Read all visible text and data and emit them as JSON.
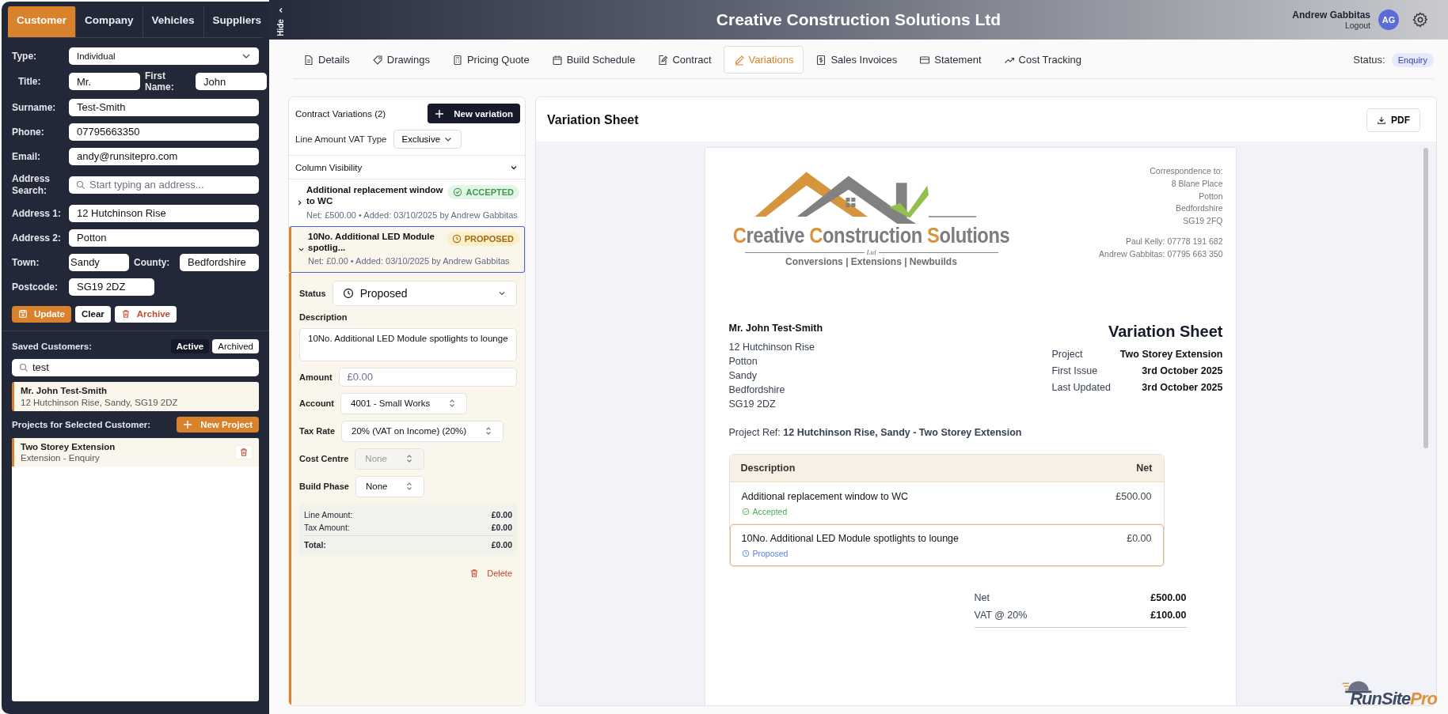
{
  "sidebar": {
    "tabs": [
      {
        "label": "Customer",
        "selected": true
      },
      {
        "label": "Company",
        "selected": false
      },
      {
        "label": "Vehicles",
        "selected": false
      },
      {
        "label": "Suppliers",
        "selected": false
      }
    ],
    "hide_label": "Hide",
    "type": {
      "label": "Type:",
      "value": "Individual"
    },
    "title": {
      "label": "Title:",
      "value": "Mr."
    },
    "first_name": {
      "label": "First Name:",
      "value": "John"
    },
    "fields": [
      {
        "label": "Surname:",
        "value": "Test-Smith"
      },
      {
        "label": "Phone:",
        "value": "07795663350"
      },
      {
        "label": "Email:",
        "value": "andy@runsitepro.com"
      }
    ],
    "address_search": {
      "label": "Address Search:",
      "placeholder": "Start typing an address..."
    },
    "address_fields": [
      {
        "label": "Address 1:",
        "value": "12 Hutchinson Rise"
      },
      {
        "label": "Address 2:",
        "value": "Potton"
      }
    ],
    "town": {
      "label": "Town:",
      "value": "Sandy"
    },
    "county": {
      "label": "County:",
      "value": "Bedfordshire"
    },
    "postcode": {
      "label": "Postcode:",
      "value": "SG19 2DZ"
    },
    "buttons": {
      "update": "Update",
      "clear": "Clear",
      "archive": "Archive"
    },
    "saved": {
      "label": "Saved Customers:",
      "filters": [
        {
          "label": "Active",
          "selected": true
        },
        {
          "label": "Archived",
          "selected": false
        }
      ],
      "search_value": "test",
      "items": [
        {
          "name": "Mr. John Test-Smith",
          "address": "12 Hutchinson Rise, Sandy, SG19 2DZ",
          "selected": true
        }
      ]
    },
    "projects": {
      "label": "Projects for Selected Customer:",
      "new_button": "New Project",
      "items": [
        {
          "name": "Two Storey Extension",
          "subtitle": "Extension - Enquiry",
          "selected": true
        }
      ]
    }
  },
  "header": {
    "title": "Creative Construction Solutions Ltd",
    "user_name": "Andrew Gabbitas",
    "logout": "Logout",
    "avatar": "AG"
  },
  "tabs": [
    {
      "label": "Details",
      "selected": false
    },
    {
      "label": "Drawings",
      "selected": false
    },
    {
      "label": "Pricing Quote",
      "selected": false
    },
    {
      "label": "Build Schedule",
      "selected": false
    },
    {
      "label": "Contract",
      "selected": false
    },
    {
      "label": "Variations",
      "selected": true
    },
    {
      "label": "Sales Invoices",
      "selected": false
    },
    {
      "label": "Statement",
      "selected": false
    },
    {
      "label": "Cost Tracking",
      "selected": false
    }
  ],
  "status": {
    "label": "Status:",
    "value": "Enquiry"
  },
  "variations": {
    "title": "Contract Variations (2)",
    "new_button": "New variation",
    "vat_label": "Line Amount VAT Type",
    "vat_value": "Exclusive",
    "column_visibility": {
      "label": "Column Visibility",
      "expanded": false
    },
    "items": [
      {
        "title": "Additional replacement window to WC",
        "meta": "Net: £500.00 • Added: 03/10/2025 by Andrew Gabbitas",
        "status": "ACCEPTED",
        "kind": "accepted",
        "expanded": false,
        "selected": false
      },
      {
        "title": "10No. Additional LED Module spotlig...",
        "meta": "Net: £0.00 • Added: 03/10/2025 by Andrew Gabbitas",
        "status": "PROPOSED",
        "kind": "proposed",
        "expanded": true,
        "selected": true
      }
    ],
    "editor": {
      "status": {
        "label": "Status",
        "value": "Proposed"
      },
      "description": {
        "label": "Description",
        "value": "10No. Additional LED Module spotlights to lounge"
      },
      "amount": {
        "label": "Amount",
        "placeholder": "£0.00"
      },
      "selects": [
        {
          "label": "Account",
          "value": "4001 - Small Works",
          "disabled": false
        },
        {
          "label": "Tax Rate",
          "value": "20% (VAT on Income) (20%)",
          "disabled": false
        },
        {
          "label": "Cost Centre",
          "value": "None",
          "disabled": true
        },
        {
          "label": "Build Phase",
          "value": "None",
          "disabled": false
        }
      ],
      "totals": [
        {
          "label": "Line Amount:",
          "value": "£0.00"
        },
        {
          "label": "Tax Amount:",
          "value": "£0.00"
        },
        {
          "label": "Total:",
          "value": "£0.00"
        }
      ],
      "delete": "Delete"
    }
  },
  "sheet": {
    "heading": "Variation Sheet",
    "pdf_button": "PDF",
    "logo": {
      "words": [
        "Creative",
        "Construction",
        "Solutions"
      ],
      "suffix": "Ltd",
      "tagline": "Conversions | Extensions | Newbuilds"
    },
    "correspondence": [
      "Correspondence to:",
      "8 Blane Place",
      "Potton",
      "Bedfordshire",
      "SG19 2FQ"
    ],
    "contacts": [
      "Paul Kelly: 07778 191 682",
      "Andrew Gabbitas: 07795 663 350"
    ],
    "recipient": "Mr. John Test-Smith",
    "address": [
      "12 Hutchinson Rise",
      "Potton",
      "Sandy",
      "Bedfordshire",
      "SG19 2DZ"
    ],
    "title": "Variation Sheet",
    "meta": [
      {
        "label": "Project",
        "value": "Two Storey Extension"
      },
      {
        "label": "First Issue",
        "value": "3rd October 2025"
      },
      {
        "label": "Last Updated",
        "value": "3rd October 2025"
      }
    ],
    "project_ref": {
      "label": "Project Ref:",
      "value": "12 Hutchinson Rise, Sandy - Two Storey Extension"
    },
    "columns": [
      "Description",
      "Net"
    ],
    "rows": [
      {
        "description": "Additional replacement window to WC",
        "status": "Accepted",
        "kind": "accepted",
        "net": "£500.00",
        "selected": false
      },
      {
        "description": "10No. Additional LED Module spotlights to lounge",
        "status": "Proposed",
        "kind": "proposed",
        "net": "£0.00",
        "selected": true
      }
    ],
    "totals": [
      {
        "label": "Net",
        "value": "£500.00"
      },
      {
        "label": "VAT @ 20%",
        "value": "£100.00"
      }
    ]
  },
  "branding": {
    "first": "RunSite",
    "second": "Pro"
  }
}
